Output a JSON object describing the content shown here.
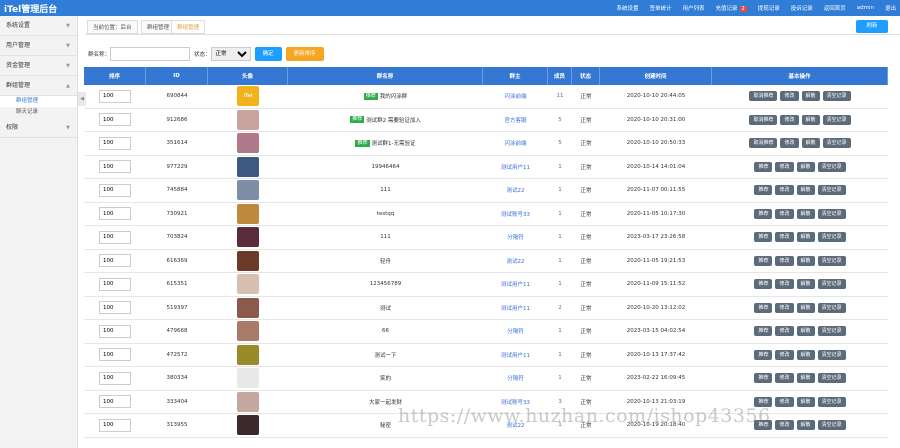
{
  "app": {
    "title": "iTel管理后台"
  },
  "topnav": [
    {
      "label": "系统设置"
    },
    {
      "label": "签单统计"
    },
    {
      "label": "用户列表"
    },
    {
      "label": "充值记录",
      "badge": "2"
    },
    {
      "label": "提现记录"
    },
    {
      "label": "投诉记录"
    },
    {
      "label": "返回首页"
    },
    {
      "label": "admin"
    },
    {
      "label": "退出"
    }
  ],
  "sidebar": {
    "items": [
      {
        "label": "系统设置"
      },
      {
        "label": "用户管理"
      },
      {
        "label": "资金管理"
      },
      {
        "label": "群组管理",
        "sub": [
          {
            "label": "群组管理",
            "active": true
          },
          {
            "label": "聊天记录"
          }
        ]
      },
      {
        "label": "权限"
      }
    ]
  },
  "tabs": [
    {
      "label": "当前位置：后台"
    },
    {
      "label": "群组管理"
    },
    {
      "label": "群组管理",
      "active": true
    }
  ],
  "refresh_label": "刷新",
  "filter": {
    "name_label": "群名称：",
    "name_value": "",
    "status_label": "状态：",
    "status_value": "正常",
    "search_label": "确定",
    "sort_label": "更新排序"
  },
  "table": {
    "headers": [
      "排序",
      "ID",
      "头像",
      "群名称",
      "群主",
      "成员",
      "状态",
      "创建时间",
      "基本操作"
    ],
    "rows": [
      {
        "sort": "100",
        "id": "690844",
        "avatar_color": "#f2b21b",
        "avatar_text": "iTel",
        "tag": "推荐",
        "name": "我的闪涂群",
        "owner": "闪涂前端",
        "members": "11",
        "status": "正常",
        "created": "2020-10-10 20:44:05",
        "ops": [
          "取消推荐",
          "修改",
          "解散",
          "清空记录"
        ]
      },
      {
        "sort": "100",
        "id": "912686",
        "avatar_color": "#c9a3a0",
        "tag": "推荐",
        "name": "测试群2 需要验证加入",
        "owner": "官方客服",
        "members": "5",
        "status": "正常",
        "created": "2020-10-10 20:31:00",
        "ops": [
          "取消推荐",
          "修改",
          "解散",
          "清空记录"
        ]
      },
      {
        "sort": "100",
        "id": "351614",
        "avatar_color": "#b07a8a",
        "tag": "推荐",
        "name": "测试群1-无需验证",
        "owner": "闪涂前端",
        "members": "5",
        "status": "正常",
        "created": "2020-10-10 20:50:33",
        "ops": [
          "取消推荐",
          "修改",
          "解散",
          "清空记录"
        ]
      },
      {
        "sort": "100",
        "id": "977229",
        "avatar_color": "#3d5a80",
        "name": "19946464",
        "owner": "测试用户11",
        "members": "1",
        "status": "正常",
        "created": "2020-10-14 14:01:04",
        "ops": [
          "推荐",
          "修改",
          "解散",
          "清空记录"
        ]
      },
      {
        "sort": "100",
        "id": "745884",
        "avatar_color": "#7d8fa6",
        "name": "111",
        "owner": "测试22",
        "members": "1",
        "status": "正常",
        "created": "2020-11-07 00:11:55",
        "ops": [
          "推荐",
          "修改",
          "解散",
          "清空记录"
        ]
      },
      {
        "sort": "100",
        "id": "730921",
        "avatar_color": "#c08a3e",
        "name": "testqq",
        "owner": "测试账号33",
        "members": "1",
        "status": "正常",
        "created": "2020-11-05 10:17:30",
        "ops": [
          "推荐",
          "修改",
          "解散",
          "清空记录"
        ]
      },
      {
        "sort": "100",
        "id": "703824",
        "avatar_color": "#5a2c3a",
        "name": "111",
        "owner": "分隔符",
        "members": "1",
        "status": "正常",
        "created": "2023-03-17 23:26:58",
        "ops": [
          "推荐",
          "修改",
          "解散",
          "清空记录"
        ]
      },
      {
        "sort": "100",
        "id": "616369",
        "avatar_color": "#6b3a2a",
        "name": "轻舟",
        "owner": "测试22",
        "members": "1",
        "status": "正常",
        "created": "2020-11-05 19:21:53",
        "ops": [
          "推荐",
          "修改",
          "解散",
          "清空记录"
        ]
      },
      {
        "sort": "100",
        "id": "615351",
        "avatar_color": "#d8c0b0",
        "name": "123456789",
        "owner": "测试用户11",
        "members": "1",
        "status": "正常",
        "created": "2020-11-09 15:11:52",
        "ops": [
          "推荐",
          "修改",
          "解散",
          "清空记录"
        ]
      },
      {
        "sort": "100",
        "id": "519397",
        "avatar_color": "#8c5a4a",
        "name": "测试",
        "owner": "测试用户11",
        "members": "2",
        "status": "正常",
        "created": "2020-10-20 13:12:02",
        "ops": [
          "推荐",
          "修改",
          "解散",
          "清空记录"
        ]
      },
      {
        "sort": "100",
        "id": "479668",
        "avatar_color": "#a97a6a",
        "name": "66",
        "owner": "分隔符",
        "members": "1",
        "status": "正常",
        "created": "2023-03-15 04:02:54",
        "ops": [
          "推荐",
          "修改",
          "解散",
          "清空记录"
        ]
      },
      {
        "sort": "100",
        "id": "472572",
        "avatar_color": "#9a8a2a",
        "name": "测试一下",
        "owner": "测试用户11",
        "members": "1",
        "status": "正常",
        "created": "2020-10-13 17:37:42",
        "ops": [
          "推荐",
          "修改",
          "解散",
          "清空记录"
        ]
      },
      {
        "sort": "100",
        "id": "380334",
        "avatar_color": "#e8e8e8",
        "name": "笑的",
        "owner": "分隔符",
        "members": "1",
        "status": "正常",
        "created": "2023-02-22 16:09:45",
        "ops": [
          "推荐",
          "修改",
          "解散",
          "清空记录"
        ]
      },
      {
        "sort": "100",
        "id": "333404",
        "avatar_color": "#c4a8a0",
        "name": "大家一起发财",
        "owner": "测试账号33",
        "members": "3",
        "status": "正常",
        "created": "2020-10-13 21:03:19",
        "ops": [
          "推荐",
          "修改",
          "解散",
          "清空记录"
        ]
      },
      {
        "sort": "100",
        "id": "313955",
        "avatar_color": "#3a2a2a",
        "name": "秘密",
        "owner": "测试22",
        "members": "1",
        "status": "正常",
        "created": "2020-10-19 20:18:40",
        "ops": [
          "推荐",
          "修改",
          "解散",
          "清空记录"
        ]
      }
    ]
  },
  "watermark": "https://www.huzhan.com/ishop43356"
}
